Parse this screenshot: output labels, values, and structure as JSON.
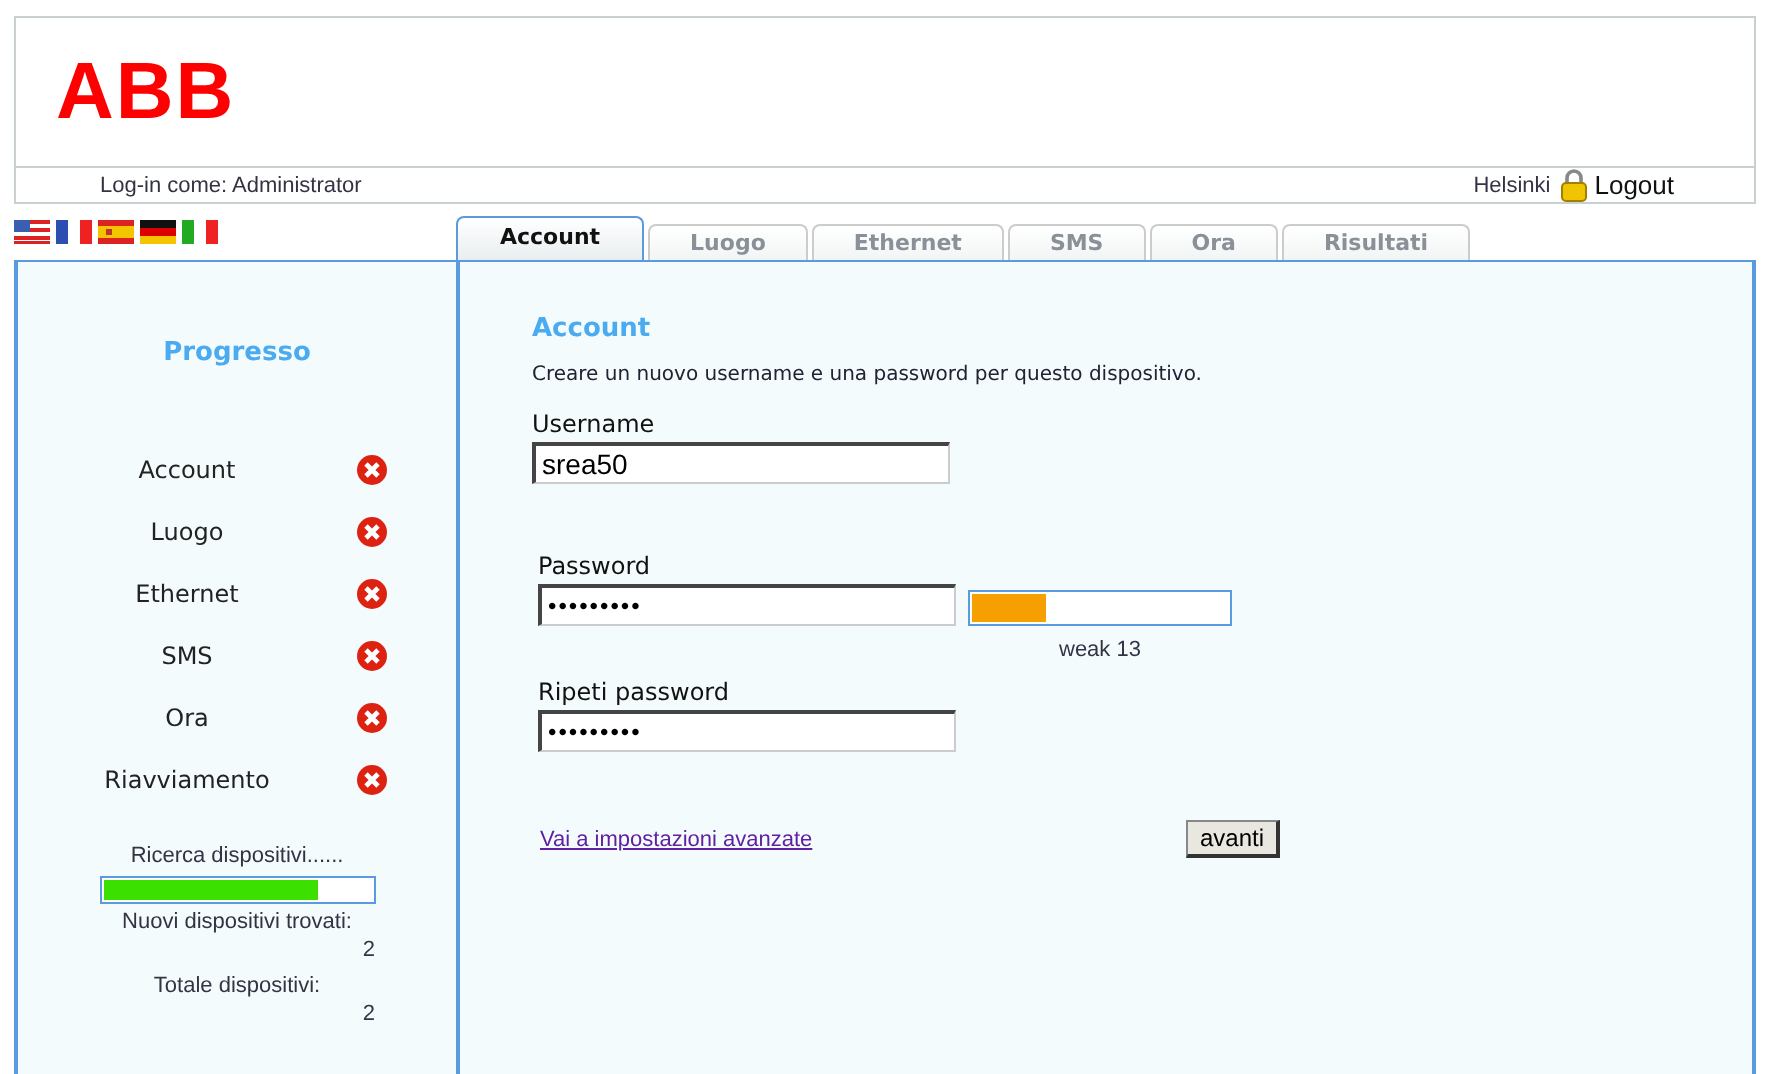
{
  "header": {
    "logo": "ABB",
    "login_as": "Log-in come: Administrator",
    "location": "Helsinki",
    "logout": "Logout"
  },
  "languages": [
    {
      "kind": "us"
    },
    {
      "kind": "fr"
    },
    {
      "kind": "es"
    },
    {
      "kind": "de"
    },
    {
      "kind": "it"
    }
  ],
  "tabs": [
    {
      "label": "Account",
      "selected": true
    },
    {
      "label": "Luogo",
      "selected": false
    },
    {
      "label": "Ethernet",
      "selected": false
    },
    {
      "label": "SMS",
      "selected": false
    },
    {
      "label": "Ora",
      "selected": false
    },
    {
      "label": "Risultati",
      "selected": false
    }
  ],
  "sidebar": {
    "title": "Progresso",
    "steps": [
      {
        "label": "Account",
        "done": false
      },
      {
        "label": "Luogo",
        "done": false
      },
      {
        "label": "Ethernet",
        "done": false
      },
      {
        "label": "SMS",
        "done": false
      },
      {
        "label": "Ora",
        "done": false
      },
      {
        "label": "Riavviamento",
        "done": false
      }
    ],
    "search": {
      "label": "Ricerca dispositivi......",
      "level": 0.8
    },
    "new_label": "Nuovi dispositivi trovati:",
    "new_count": "2",
    "total_label": "Totale dispositivi:",
    "total_count": "2"
  },
  "form": {
    "title": "Account",
    "description": "Creare un nuovo username e una password per questo dispositivo.",
    "username": {
      "label": "Username",
      "value": "srea50"
    },
    "password": {
      "label": "Password",
      "value": "•••••••••"
    },
    "strength": {
      "level": 0.29,
      "reading": "weak 13"
    },
    "repeat": {
      "label": "Ripeti password",
      "value": "•••••••••"
    },
    "advanced_link": "Vai a impostazioni avanzate",
    "next_button": "avanti"
  }
}
